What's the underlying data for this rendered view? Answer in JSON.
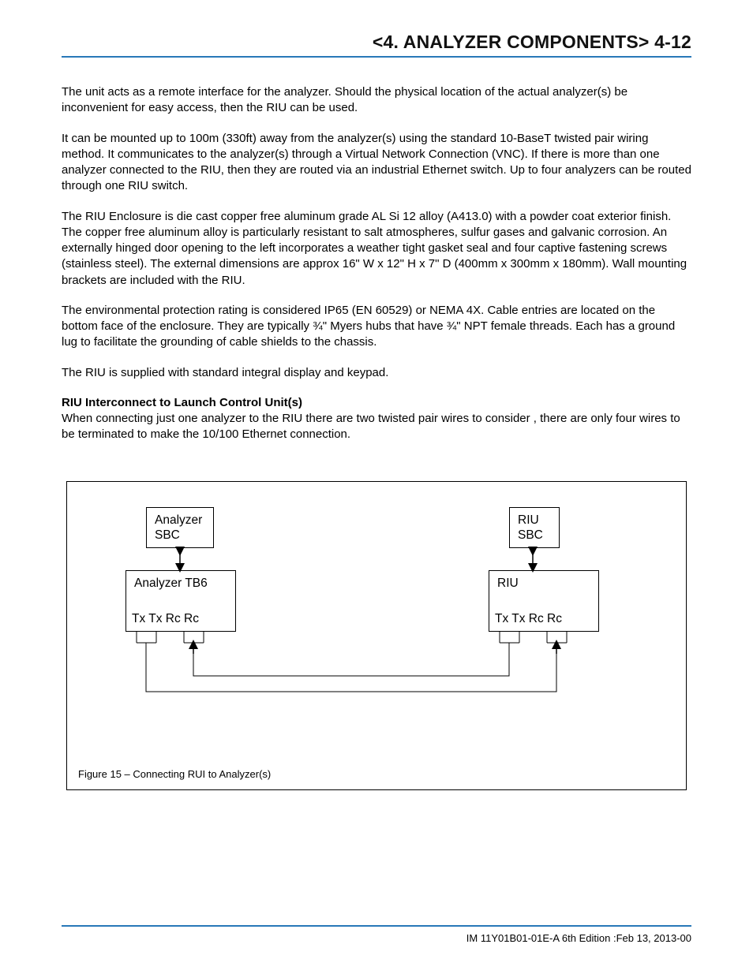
{
  "header": {
    "title": "<4. ANALYZER COMPONENTS>  4-12"
  },
  "paragraphs": {
    "p1": "The unit acts as a remote interface for the analyzer. Should the physical location of the actual analyzer(s) be inconvenient for easy access, then the RIU can be used.",
    "p2": "It can be mounted up to 100m (330ft) away from the analyzer(s) using the standard 10-BaseT twisted pair wiring method. It communicates to the analyzer(s) through a Virtual Network Connection (VNC). If there is more than one analyzer connected to the RIU, then they are routed via an industrial Ethernet switch. Up to four analyzers can be routed through one RIU switch.",
    "p3": "The RIU Enclosure is die cast copper free aluminum grade AL Si 12 alloy (A413.0) with a powder coat exterior finish. The copper free aluminum alloy is particularly resistant to salt atmospheres, sulfur gases and galvanic corrosion. An externally hinged door opening to the left incorporates a weather tight gasket seal and four captive fastening screws (stainless steel). The external dimensions are approx 16\" W x 12\" H x 7\" D (400mm x 300mm x 180mm). Wall mounting brackets are included with the RIU.",
    "p4": "The environmental protection rating is considered IP65 (EN 60529) or NEMA 4X. Cable entries are located on the bottom face of the enclosure. They are typically ¾\" Myers hubs that have ¾\" NPT female threads. Each has a ground lug to facilitate the grounding of cable shields to the chassis.",
    "p5": "The RIU is supplied with standard integral display and keypad.",
    "h1": "RIU Interconnect to Launch Control Unit(s)",
    "p6": "When connecting just one analyzer to the RIU there are two twisted pair wires to consider , there are only four wires to be terminated to make the 10/100 Ethernet connection."
  },
  "figure": {
    "caption": "Figure 15 – Connecting RUI to Analyzer(s)",
    "boxes": {
      "analyzer_sbc": "Analyzer\nSBC",
      "analyzer_tb6": "Analyzer TB6",
      "riu_sbc": "RIU\nSBC",
      "riu": "RIU"
    },
    "labels": {
      "txrc_left": "Tx Tx   Rc Rc",
      "txrc_right": "Tx Tx   Rc Rc"
    }
  },
  "footer": {
    "text": "IM 11Y01B01-01E-A    6th Edition :Feb 13, 2013-00"
  }
}
